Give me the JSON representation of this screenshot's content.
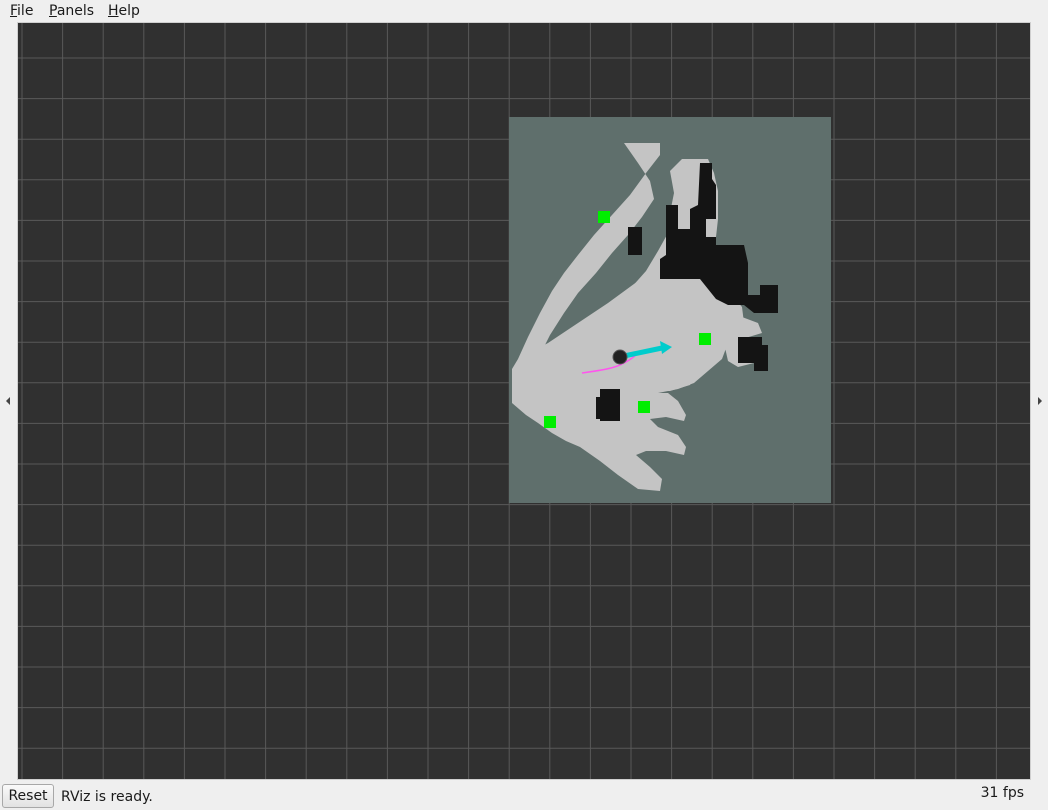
{
  "menu": {
    "file": {
      "mnemonic": "F",
      "rest": "ile"
    },
    "panels": {
      "mnemonic": "P",
      "rest": "anels"
    },
    "help": {
      "mnemonic": "H",
      "rest": "elp"
    }
  },
  "status": {
    "reset_label": "Reset",
    "message": "RViz is ready.",
    "fps": "31 fps"
  },
  "colors": {
    "background": "#303030",
    "grid": "#595959",
    "map_unknown": "#5f6f6c",
    "map_free": "#c4c4c4",
    "map_occupied": "#141414",
    "goal_markers": "#00ee00",
    "pose_arrow": "#00cccc",
    "path": "#ff55ee",
    "robot": "#222222"
  },
  "icons": {
    "left_panel_toggle": "triangle-left-icon",
    "right_panel_toggle": "triangle-right-icon"
  }
}
